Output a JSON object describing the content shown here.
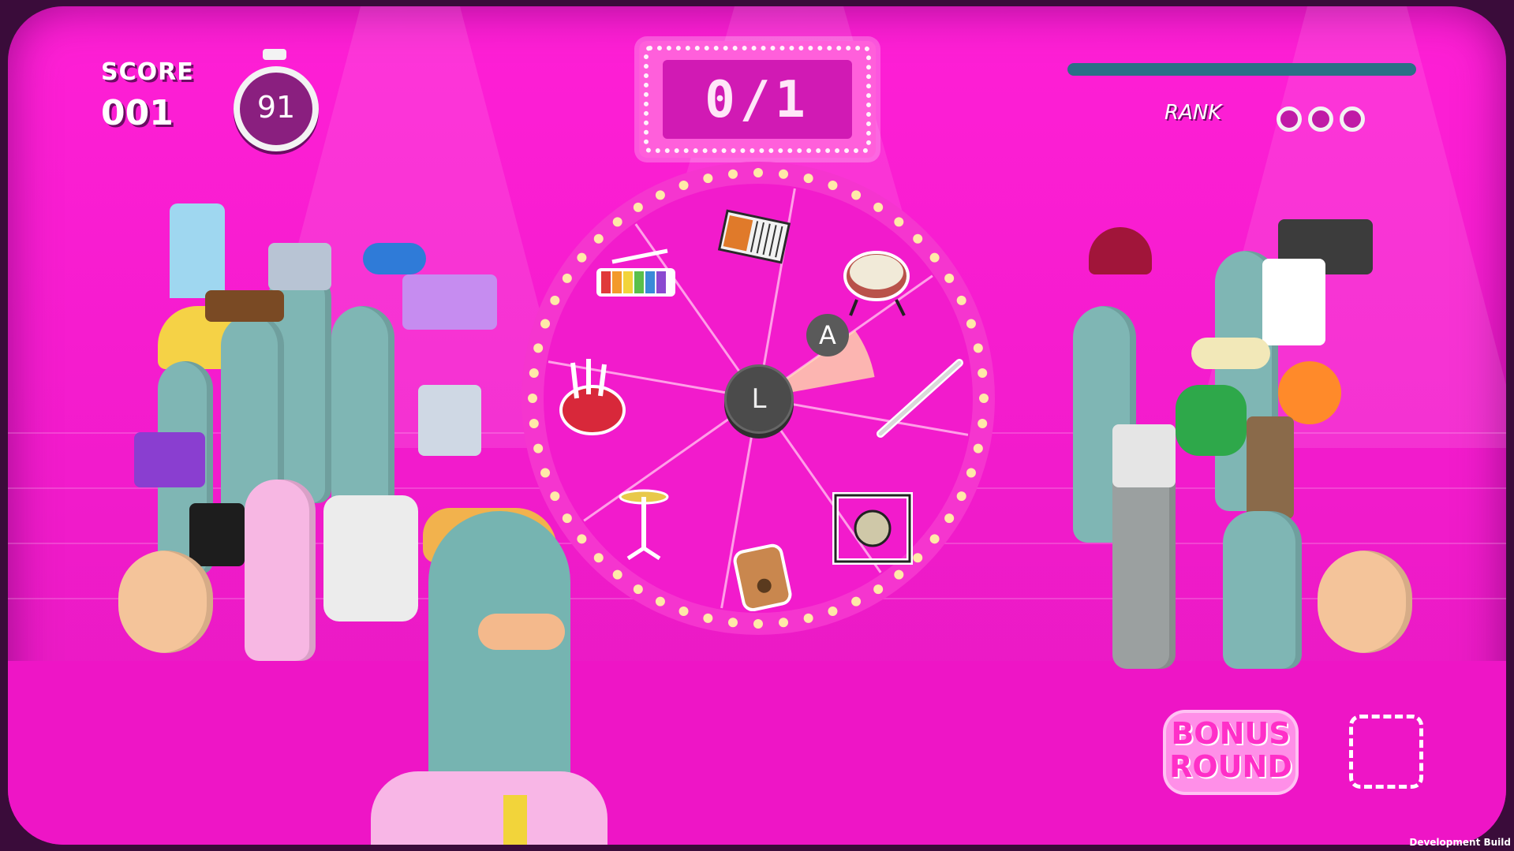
{
  "hud": {
    "score_label": "SCORE",
    "score_value": "001",
    "timer_value": "91",
    "counter_text": "0/1",
    "rank_label": "RANK",
    "rank_pips": 3
  },
  "wheel": {
    "center_button": "L",
    "confirm_button": "A",
    "segments": [
      {
        "name": "accordion-icon"
      },
      {
        "name": "bass-drum-icon"
      },
      {
        "name": "flute-icon"
      },
      {
        "name": "gong-icon"
      },
      {
        "name": "kalimba-icon"
      },
      {
        "name": "cymbal-icon"
      },
      {
        "name": "bagpipes-icon"
      },
      {
        "name": "xylophone-icon"
      }
    ],
    "highlighted_segment": "bass-drum-icon"
  },
  "bonus": {
    "line1": "BONUS",
    "line2": "ROUND"
  },
  "footer": {
    "build_label": "Development Build"
  },
  "colors": {
    "background": "#f21bcc",
    "bird": "#7fb6b4",
    "beak": "#f3b07a",
    "wheel_light": "#ffe9a8"
  }
}
